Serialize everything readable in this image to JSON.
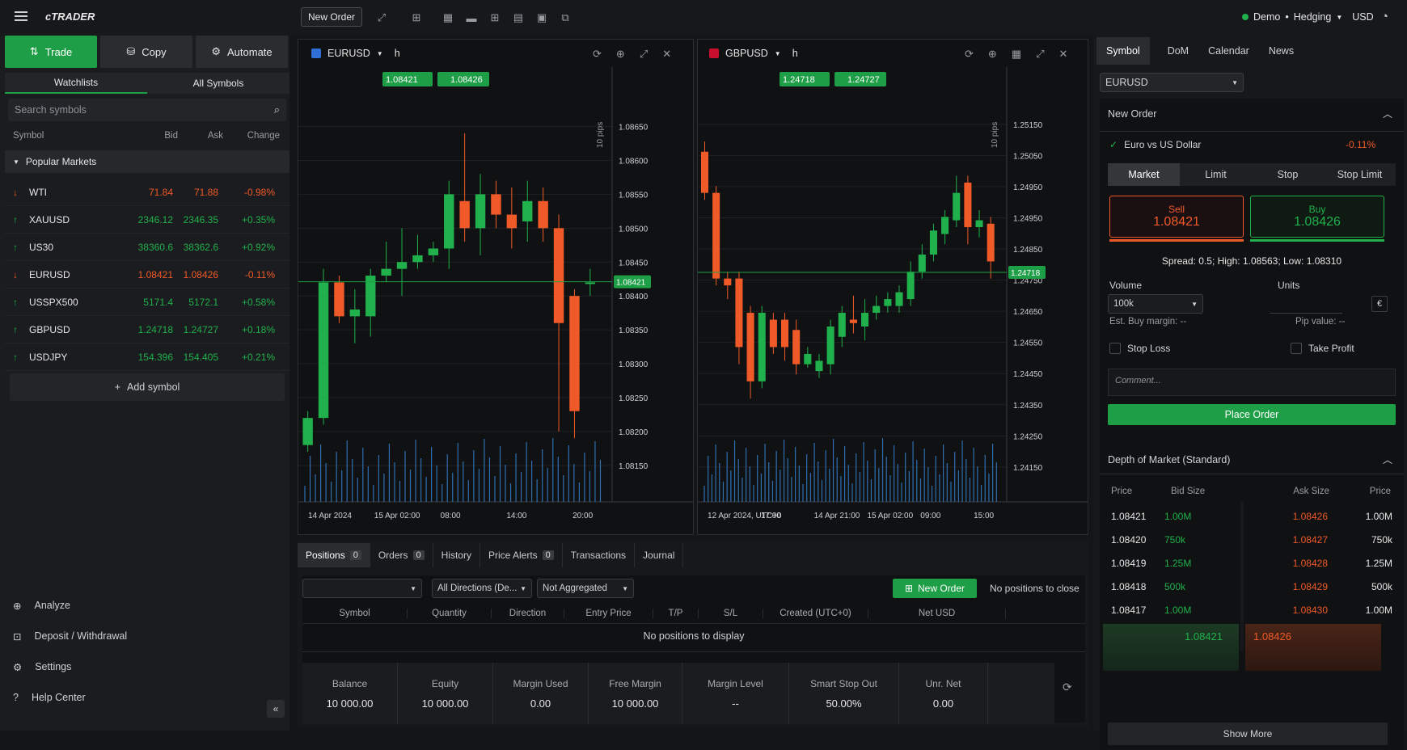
{
  "app": {
    "logo": "cTRADER",
    "new_order": "New Order",
    "account": "Demo",
    "mode": "Hedging",
    "currency": "USD"
  },
  "left": {
    "tabs": [
      "Trade",
      "Copy",
      "Automate"
    ],
    "subtabs": [
      "Watchlists",
      "All Symbols"
    ],
    "search_placeholder": "Search symbols",
    "headers": [
      "Symbol",
      "Bid",
      "Ask",
      "Change"
    ],
    "group": "Popular Markets",
    "rows": [
      {
        "symbol": "WTI",
        "bid": "71.84",
        "ask": "71.88",
        "change": "-0.98%",
        "dir": "down"
      },
      {
        "symbol": "XAUUSD",
        "bid": "2346.12",
        "ask": "2346.35",
        "change": "+0.35%",
        "dir": "up"
      },
      {
        "symbol": "US30",
        "bid": "38360.6",
        "ask": "38362.6",
        "change": "+0.92%",
        "dir": "up"
      },
      {
        "symbol": "EURUSD",
        "bid": "1.08421",
        "ask": "1.08426",
        "change": "-0.11%",
        "dir": "down"
      },
      {
        "symbol": "USSPX500",
        "bid": "5171.4",
        "ask": "5172.1",
        "change": "+0.58%",
        "dir": "up"
      },
      {
        "symbol": "GBPUSD",
        "bid": "1.24718",
        "ask": "1.24727",
        "change": "+0.18%",
        "dir": "up"
      },
      {
        "symbol": "USDJPY",
        "bid": "154.396",
        "ask": "154.405",
        "change": "+0.21%",
        "dir": "up"
      }
    ],
    "add_symbol": "Add symbol",
    "nav": [
      "Analyze",
      "Deposit / Withdrawal",
      "Settings",
      "Help Center"
    ]
  },
  "charts": [
    {
      "symbol": "EURUSD",
      "tf": "h",
      "bid": "1.08421",
      "ask": "1.08426",
      "pips": "10 pips",
      "current": "1.08421",
      "yticks": [
        "1.08650",
        "1.08600",
        "1.08550",
        "1.08500",
        "1.08450",
        "1.08400",
        "1.08350",
        "1.08300",
        "1.08250",
        "1.08200",
        "1.08150"
      ],
      "xticks": [
        "14 Apr 2024",
        "15 Apr 02:00",
        "08:00",
        "14:00",
        "20:00"
      ],
      "candles": [
        [
          1.0818,
          1.0822,
          1.0817,
          1.0823
        ],
        [
          1.0822,
          1.0842,
          1.0821,
          1.0844
        ],
        [
          1.0842,
          1.0837,
          1.0836,
          1.0843
        ],
        [
          1.0837,
          1.0838,
          1.0833,
          1.0841
        ],
        [
          1.0837,
          1.0843,
          1.0834,
          1.0844
        ],
        [
          1.0843,
          1.0844,
          1.0842,
          1.0848
        ],
        [
          1.0844,
          1.0845,
          1.084,
          1.085
        ],
        [
          1.0845,
          1.0846,
          1.0844,
          1.0849
        ],
        [
          1.0846,
          1.0847,
          1.0845,
          1.0848
        ],
        [
          1.0847,
          1.0855,
          1.0844,
          1.0857
        ],
        [
          1.0854,
          1.085,
          1.0848,
          1.0864
        ],
        [
          1.085,
          1.0855,
          1.0846,
          1.0858
        ],
        [
          1.0855,
          1.0852,
          1.085,
          1.0857
        ],
        [
          1.0852,
          1.085,
          1.0847,
          1.0856
        ],
        [
          1.0851,
          1.0854,
          1.0848,
          1.0857
        ],
        [
          1.0854,
          1.085,
          1.0848,
          1.0856
        ],
        [
          1.085,
          1.0836,
          1.082,
          1.0852
        ],
        [
          1.084,
          1.0823,
          1.0819,
          1.0841
        ],
        [
          1.0842,
          1.0842,
          1.084,
          1.0844
        ]
      ]
    },
    {
      "symbol": "GBPUSD",
      "tf": "h",
      "bid": "1.24718",
      "ask": "1.24727",
      "pips": "10 pips",
      "current": "1.24718",
      "yticks": [
        "1.25150",
        "1.25050",
        "1.24950",
        "1.24950",
        "1.24850",
        "1.24750",
        "1.24650",
        "1.24550",
        "1.24450",
        "1.24350",
        "1.24250",
        "1.24150"
      ],
      "xticks": [
        "12 Apr 2024, UTC+0",
        "17:00",
        "14 Apr 21:00",
        "15 Apr 02:00",
        "09:00",
        "15:00"
      ],
      "candles": [
        [
          1.2507,
          1.2495,
          1.2493,
          1.251
        ],
        [
          1.2495,
          1.247,
          1.2468,
          1.2497
        ],
        [
          1.247,
          1.2468,
          1.2464,
          1.2472
        ],
        [
          1.247,
          1.245,
          1.2445,
          1.2472
        ],
        [
          1.246,
          1.244,
          1.2435,
          1.2462
        ],
        [
          1.244,
          1.246,
          1.2438,
          1.2462
        ],
        [
          1.2458,
          1.245,
          1.2448,
          1.246
        ],
        [
          1.2458,
          1.245,
          1.2446,
          1.246
        ],
        [
          1.2455,
          1.2445,
          1.2442,
          1.2458
        ],
        [
          1.2445,
          1.2448,
          1.2444,
          1.245
        ],
        [
          1.2443,
          1.2446,
          1.2441,
          1.2448
        ],
        [
          1.2445,
          1.2456,
          1.2442,
          1.2458
        ],
        [
          1.2453,
          1.246,
          1.245,
          1.2462
        ],
        [
          1.2458,
          1.2457,
          1.2454,
          1.2465
        ],
        [
          1.2456,
          1.246,
          1.2452,
          1.2464
        ],
        [
          1.246,
          1.2462,
          1.2458,
          1.2465
        ],
        [
          1.2462,
          1.2464,
          1.246,
          1.2466
        ],
        [
          1.2462,
          1.2466,
          1.246,
          1.2468
        ],
        [
          1.2464,
          1.2472,
          1.2462,
          1.2475
        ],
        [
          1.2472,
          1.2477,
          1.247,
          1.248
        ],
        [
          1.2477,
          1.2484,
          1.2475,
          1.2486
        ],
        [
          1.2483,
          1.2488,
          1.248,
          1.249
        ],
        [
          1.2487,
          1.2495,
          1.2485,
          1.25
        ],
        [
          1.2498,
          1.2485,
          1.248,
          1.25
        ],
        [
          1.2485,
          1.2487,
          1.2482,
          1.249
        ],
        [
          1.2486,
          1.2475,
          1.247,
          1.2488
        ]
      ]
    }
  ],
  "bottom": {
    "tabs": [
      {
        "label": "Positions",
        "count": "0"
      },
      {
        "label": "Orders",
        "count": "0"
      },
      {
        "label": "History"
      },
      {
        "label": "Price Alerts",
        "count": "0"
      },
      {
        "label": "Transactions"
      },
      {
        "label": "Journal"
      }
    ],
    "filters": {
      "dir": "All Directions (De...",
      "agg": "Not Aggregated"
    },
    "new_order": "New Order",
    "no_close": "No positions to close",
    "cols": [
      "Symbol",
      "Quantity",
      "Direction",
      "Entry Price",
      "T/P",
      "S/L",
      "Created (UTC+0)",
      "Net USD"
    ],
    "empty": "No positions to display",
    "summary": [
      {
        "label": "Balance",
        "value": "10 000.00"
      },
      {
        "label": "Equity",
        "value": "10 000.00"
      },
      {
        "label": "Margin Used",
        "value": "0.00"
      },
      {
        "label": "Free Margin",
        "value": "10 000.00"
      },
      {
        "label": "Margin Level",
        "value": "--"
      },
      {
        "label": "Smart Stop Out",
        "value": "50.00%"
      },
      {
        "label": "Unr. Net",
        "value": "0.00"
      }
    ]
  },
  "right": {
    "tabs": [
      "Symbol",
      "DoM",
      "Calendar",
      "News"
    ],
    "symbol": "EURUSD",
    "new_order": "New Order",
    "desc": "Euro vs US Dollar",
    "change": "-0.11%",
    "otabs": [
      "Market",
      "Limit",
      "Stop",
      "Stop Limit"
    ],
    "sell_label": "Sell",
    "sell": "1.08421",
    "buy_label": "Buy",
    "buy": "1.08426",
    "spread": "Spread: 0.5; High: 1.08563; Low: 1.08310",
    "volume_label": "Volume",
    "units_label": "Units",
    "volume": "100k",
    "unit_sym": "€",
    "margin": "Est. Buy margin: --",
    "pip": "Pip value: --",
    "sl": "Stop Loss",
    "tp": "Take Profit",
    "comment_ph": "Comment...",
    "place": "Place Order",
    "dom_title": "Depth of Market (Standard)",
    "dom_headers": [
      "Price",
      "Bid Size",
      "Ask Size",
      "Price"
    ],
    "dom_rows": [
      [
        "1.08421",
        "1.00M",
        "1.08426",
        "1.00M"
      ],
      [
        "1.08420",
        "750k",
        "1.08427",
        "750k"
      ],
      [
        "1.08419",
        "1.25M",
        "1.08428",
        "1.25M"
      ],
      [
        "1.08418",
        "500k",
        "1.08429",
        "500k"
      ],
      [
        "1.08417",
        "1.00M",
        "1.08430",
        "1.00M"
      ]
    ],
    "dom_bid": "1.08421",
    "dom_ask": "1.08426",
    "show_more": "Show More"
  },
  "colors": {
    "up": "#20b14c",
    "down": "#f05a28",
    "accent": "#1e9e46"
  }
}
